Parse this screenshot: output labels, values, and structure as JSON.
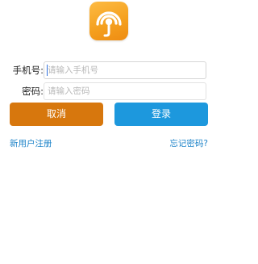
{
  "app": {
    "logo_icon": "broadcast-signal-j-icon",
    "logo_color": "#F5A11F"
  },
  "login_form": {
    "phone": {
      "label": "手机号:",
      "placeholder": "请输入手机号",
      "value": ""
    },
    "password": {
      "label": "密码:",
      "placeholder": "请输入密码",
      "value": ""
    }
  },
  "buttons": {
    "cancel_label": "取消",
    "cancel_color": "#D7770D",
    "login_label": "登录",
    "login_color": "#1D98DD"
  },
  "links": {
    "register_label": "新用户注册",
    "forgot_password_label": "忘记密码?"
  }
}
